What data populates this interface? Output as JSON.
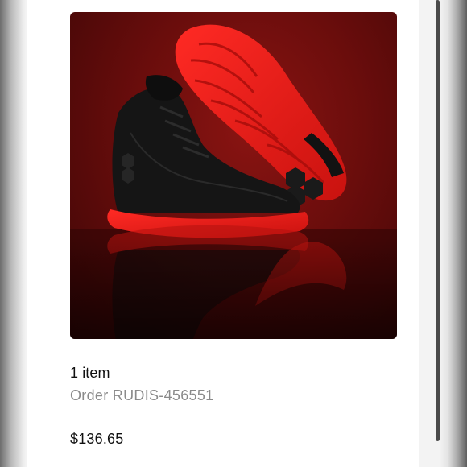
{
  "order": {
    "item_count_label": "1 item",
    "order_number_label": "Order RUDIS-456551",
    "total_price": "$136.65"
  },
  "product_image": {
    "icon": "sneaker-product-photo"
  },
  "colors": {
    "background_red": "#6a0d0c",
    "sole_red": "#e21b1b",
    "upper_black": "#141414",
    "secondary_text": "#8a8a8a",
    "primary_text": "#111111"
  }
}
